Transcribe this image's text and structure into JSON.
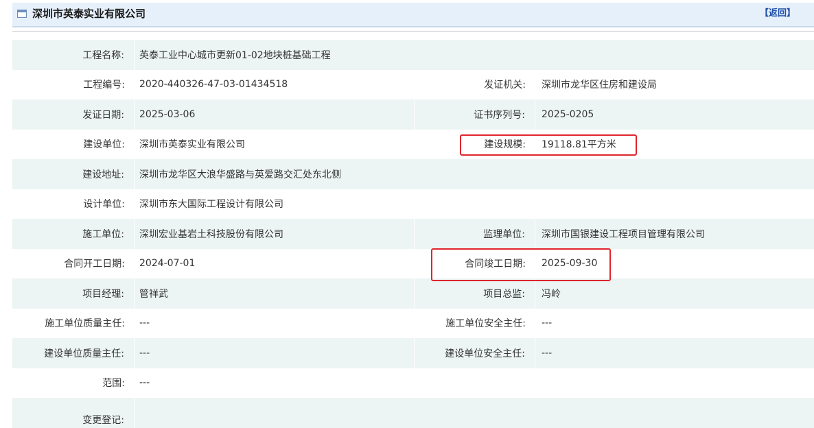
{
  "header": {
    "title": "深圳市英泰实业有限公司",
    "back_label": "【返回】"
  },
  "rows": [
    {
      "label1": "工程名称:",
      "value1": "英泰工业中心城市更新01-02地块桩基础工程",
      "label2": "",
      "value2": ""
    },
    {
      "label1": "工程编号:",
      "value1": "2020-440326-47-03-01434518",
      "label2": "发证机关:",
      "value2": "深圳市龙华区住房和建设局"
    },
    {
      "label1": "发证日期:",
      "value1": "2025-03-06",
      "label2": "证书序列号:",
      "value2": "2025-0205"
    },
    {
      "label1": "建设单位:",
      "value1": "深圳市英泰实业有限公司",
      "label2": "建设规模:",
      "value2": "19118.81平方米"
    },
    {
      "label1": "建设地址:",
      "value1": "深圳市龙华区大浪华盛路与英爱路交汇处东北侧",
      "label2": "",
      "value2": ""
    },
    {
      "label1": "设计单位:",
      "value1": "深圳市东大国际工程设计有限公司",
      "label2": "",
      "value2": ""
    },
    {
      "label1": "施工单位:",
      "value1": "深圳宏业基岩土科技股份有限公司",
      "label2": "监理单位:",
      "value2": "深圳市国银建设工程项目管理有限公司"
    },
    {
      "label1": "合同开工日期:",
      "value1": "2024-07-01",
      "label2": "合同竣工日期:",
      "value2": "2025-09-30"
    },
    {
      "label1": "项目经理:",
      "value1": "管祥武",
      "label2": "项目总监:",
      "value2": "冯岭"
    },
    {
      "label1": "施工单位质量主任:",
      "value1": "---",
      "label2": "施工单位安全主任:",
      "value2": "---"
    },
    {
      "label1": "建设单位质量主任:",
      "value1": "---",
      "label2": "建设单位安全主任:",
      "value2": "---"
    },
    {
      "label1": "范围:",
      "value1": "---",
      "label2": "",
      "value2": ""
    },
    {
      "label1": "变更登记:",
      "value1": "",
      "label2": "",
      "value2": ""
    }
  ],
  "colors": {
    "highlight": "#e0242b",
    "row_shade": "#edf4f4",
    "header_bg": "#e6f0fa",
    "link": "#1f4fa8"
  }
}
